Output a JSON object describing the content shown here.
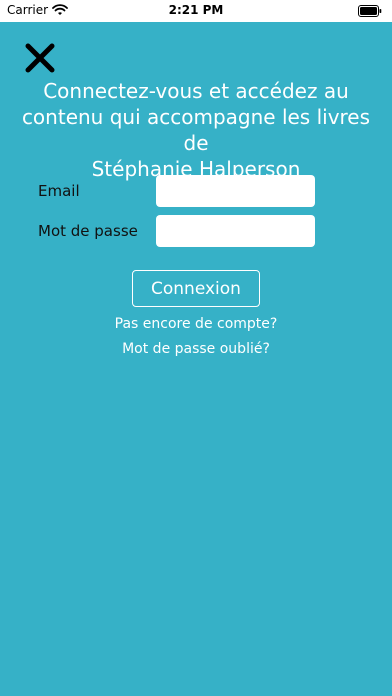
{
  "status_bar": {
    "carrier": "Carrier",
    "time": "2:21 PM"
  },
  "icons": {
    "wifi": "wifi-icon",
    "battery": "battery-icon",
    "close": "close-icon"
  },
  "colors": {
    "background": "#36b1c7",
    "text_light": "#ffffff",
    "label_text": "#111111"
  },
  "headline": {
    "line1": "Connectez-vous et accédez au",
    "line2": "contenu qui accompagne les livres de",
    "line3": "Stéphanie Halperson"
  },
  "form": {
    "email_label": "Email",
    "email_value": "",
    "password_label": "Mot de passe",
    "password_value": ""
  },
  "actions": {
    "login_label": "Connexion",
    "signup_link": "Pas encore de compte?",
    "forgot_link": "Mot de passe oublié?"
  }
}
